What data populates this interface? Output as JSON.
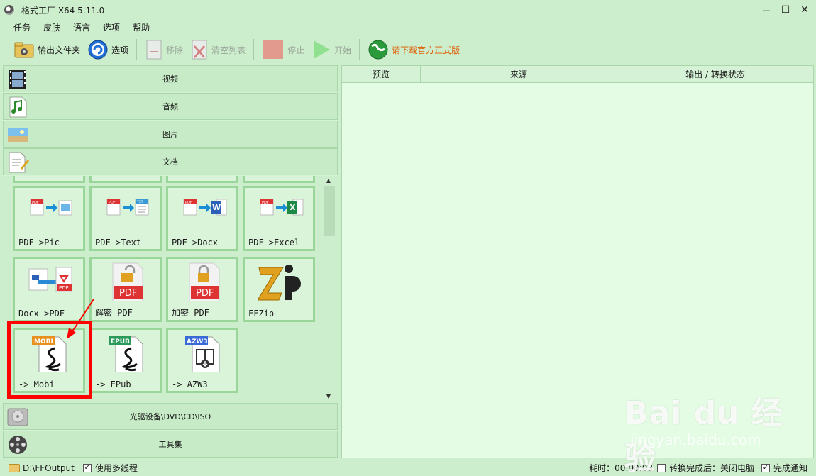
{
  "window": {
    "title": "格式工厂 X64 5.11.0",
    "minimize": "—",
    "maximize": "☐",
    "close": "✕"
  },
  "menu": [
    "任务",
    "皮肤",
    "语言",
    "选项",
    "帮助"
  ],
  "toolbar": {
    "output_folder": "输出文件夹",
    "options": "选项",
    "remove": "移除",
    "clear_list": "清空列表",
    "stop": "停止",
    "start": "开始",
    "official": "请下载官方正式版"
  },
  "categories": {
    "video": "视频",
    "audio": "音频",
    "image": "图片",
    "document": "文档",
    "disc": "光驱设备\\DVD\\CD\\ISO",
    "tools": "工具集"
  },
  "tiles": [
    {
      "label": "PDF->Pic"
    },
    {
      "label": "PDF->Text"
    },
    {
      "label": "PDF->Docx"
    },
    {
      "label": "PDF->Excel"
    },
    {
      "label": "Docx->PDF"
    },
    {
      "label": "解密 PDF"
    },
    {
      "label": "加密 PDF"
    },
    {
      "label": "FFZip"
    },
    {
      "label": "-> Mobi"
    },
    {
      "label": "-> EPub"
    },
    {
      "label": "-> AZW3"
    }
  ],
  "badges": {
    "mobi": "MOBI",
    "epub": "EPUB",
    "azw3": "AZW3",
    "pdf": "PDF",
    "txt": "TXT"
  },
  "task_table": {
    "columns": [
      "预览",
      "来源",
      "输出 / 转换状态"
    ]
  },
  "status": {
    "output_path": "D:\\FFOutput",
    "multithread": "使用多线程",
    "elapsed": "耗时：00:00:03",
    "after_convert": "转换完成后：关闭电脑",
    "notify": "完成通知"
  },
  "watermark": {
    "brand": "Bai du 经验",
    "url": "jingyan.baidu.com"
  },
  "colors": {
    "bg": "#cdeecd",
    "highlight": "#ff0000",
    "official": "#e05a00"
  }
}
